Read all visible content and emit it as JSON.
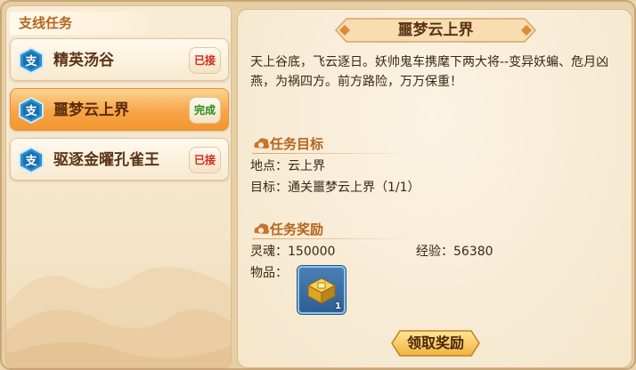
{
  "left_panel": {
    "title": "支线任务",
    "quests": [
      {
        "icon_label": "支",
        "name": "精英汤谷",
        "status": "已接",
        "status_type": "accepted",
        "active": false
      },
      {
        "icon_label": "支",
        "name": "噩梦云上界",
        "status": "完成",
        "status_type": "done",
        "active": true
      },
      {
        "icon_label": "支",
        "name": "驱逐金曜孔雀王",
        "status": "已接",
        "status_type": "accepted",
        "active": false
      }
    ]
  },
  "detail": {
    "title": "噩梦云上界",
    "description": "天上谷底，飞云逐日。妖帅鬼车携麾下两大将--变异妖蝙、危月凶燕，为祸四方。前方路险，万万保重！",
    "objective": {
      "heading": "任务目标",
      "location_line": "地点：云上界",
      "target_line": "目标：通关噩梦云上界（1/1）"
    },
    "rewards": {
      "heading": "任务奖励",
      "soul_line": "灵魂：150000",
      "exp_line": "经验：56380",
      "items_label": "物品：",
      "item": {
        "icon": "gold-treasure-chest-icon",
        "count": "1"
      }
    },
    "claim_button": "领取奖励"
  },
  "colors": {
    "accent": "#b5651d",
    "active_item": "#f7a549",
    "accepted": "#d4281a",
    "done": "#2b8a1d"
  }
}
